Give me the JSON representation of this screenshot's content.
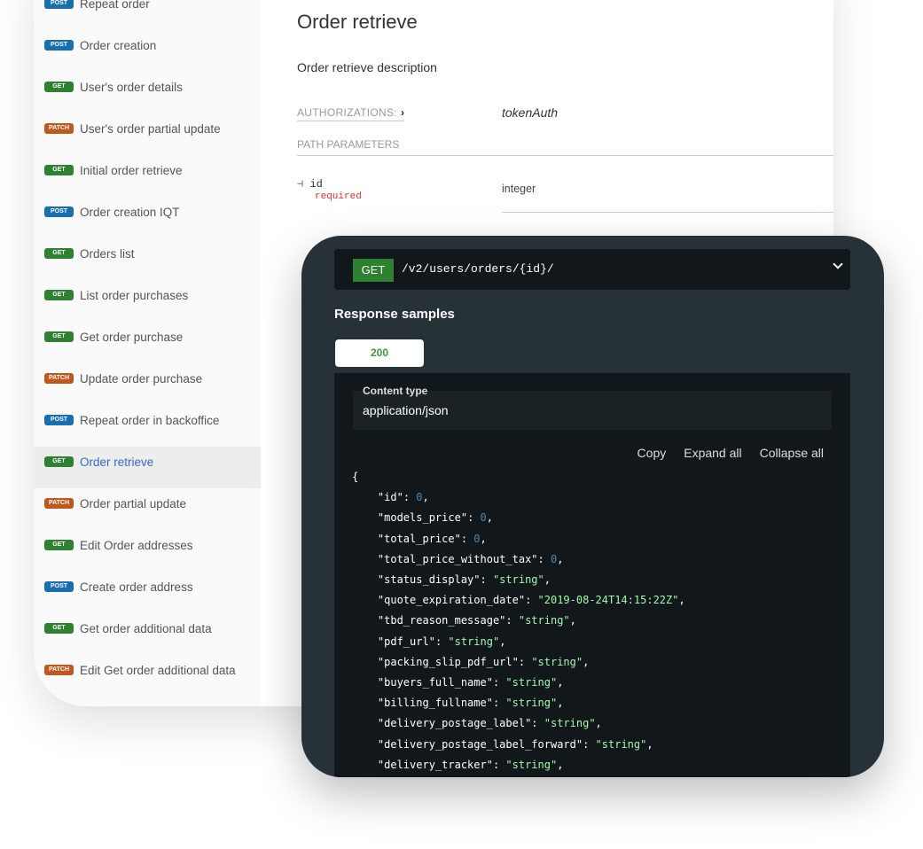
{
  "sidebar": {
    "items": [
      {
        "method": "POST",
        "label": "Repeat order"
      },
      {
        "method": "POST",
        "label": "Order creation"
      },
      {
        "method": "GET",
        "label": "User's order details"
      },
      {
        "method": "PATCH",
        "label": "User's order partial update"
      },
      {
        "method": "GET",
        "label": "Initial order retrieve"
      },
      {
        "method": "POST",
        "label": "Order creation IQT"
      },
      {
        "method": "GET",
        "label": "Orders list"
      },
      {
        "method": "GET",
        "label": "List order purchases"
      },
      {
        "method": "GET",
        "label": "Get order purchase"
      },
      {
        "method": "PATCH",
        "label": "Update order purchase"
      },
      {
        "method": "POST",
        "label": "Repeat order in backoffice"
      },
      {
        "method": "GET",
        "label": "Order retrieve",
        "active": true
      },
      {
        "method": "PATCH",
        "label": "Order partial update"
      },
      {
        "method": "GET",
        "label": "Edit Order addresses"
      },
      {
        "method": "POST",
        "label": "Create order address"
      },
      {
        "method": "GET",
        "label": "Get order additional data"
      },
      {
        "method": "PATCH",
        "label": "Edit Get order additional data"
      }
    ]
  },
  "colors": {
    "GET": "#2f8132",
    "POST": "#186faf",
    "PATCH": "#bf581d"
  },
  "main": {
    "title": "Order retrieve",
    "description": "Order retrieve description",
    "auth_label": "AUTHORIZATIONS:",
    "auth_value": "tokenAuth",
    "path_params_label": "PATH PARAMETERS",
    "param": {
      "name": "id",
      "required": "required",
      "type": "integer"
    }
  },
  "panel": {
    "method": "GET",
    "path": "/v2/users/orders/{id}/",
    "response_title": "Response samples",
    "tab": "200",
    "content_type_label": "Content type",
    "content_type": "application/json",
    "actions": [
      "Copy",
      "Expand all",
      "Collapse all"
    ],
    "json": [
      [
        "id",
        "0",
        "n"
      ],
      [
        "models_price",
        "0",
        "n"
      ],
      [
        "total_price",
        "0",
        "n"
      ],
      [
        "total_price_without_tax",
        "0",
        "n"
      ],
      [
        "status_display",
        "\"string\"",
        "s"
      ],
      [
        "quote_expiration_date",
        "\"2019-08-24T14:15:22Z\"",
        "s"
      ],
      [
        "tbd_reason_message",
        "\"string\"",
        "s"
      ],
      [
        "pdf_url",
        "\"string\"",
        "s"
      ],
      [
        "packing_slip_pdf_url",
        "\"string\"",
        "s"
      ],
      [
        "buyers_full_name",
        "\"string\"",
        "s"
      ],
      [
        "billing_fullname",
        "\"string\"",
        "s"
      ],
      [
        "delivery_postage_label",
        "\"string\"",
        "s"
      ],
      [
        "delivery_postage_label_forward",
        "\"string\"",
        "s"
      ],
      [
        "delivery_tracker",
        "\"string\"",
        "s"
      ]
    ]
  }
}
